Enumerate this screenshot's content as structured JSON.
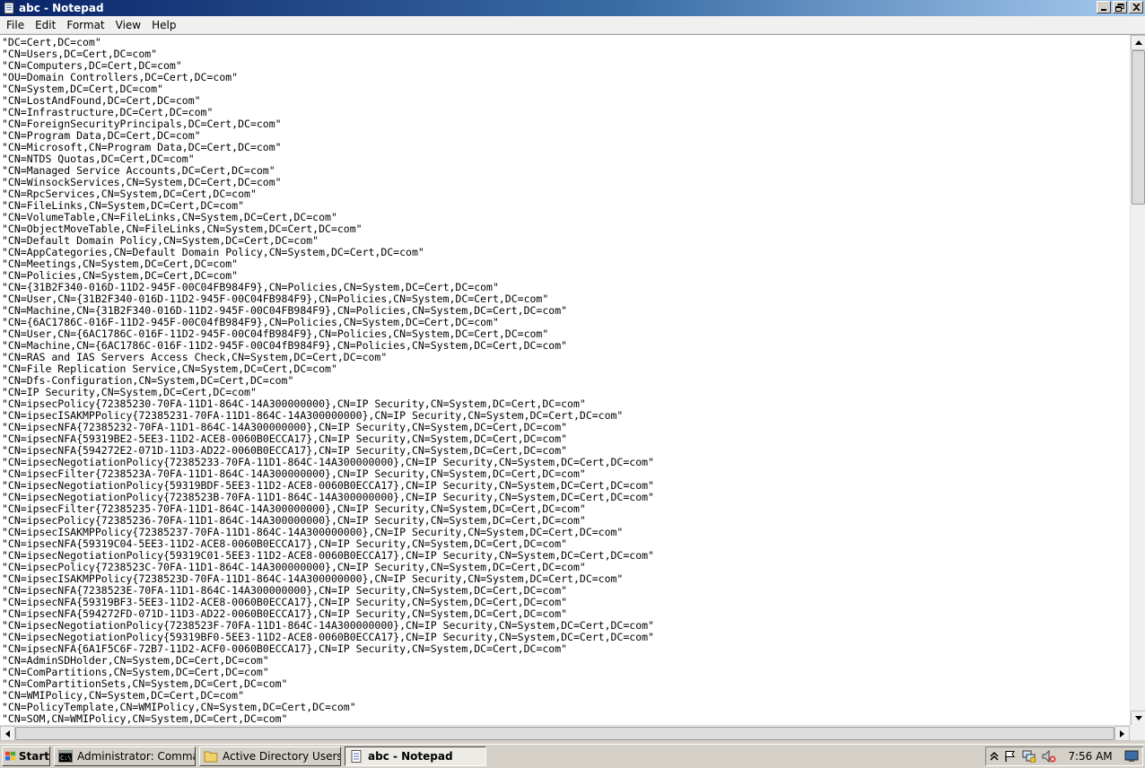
{
  "window": {
    "title": "abc - Notepad"
  },
  "menu": [
    "File",
    "Edit",
    "Format",
    "View",
    "Help"
  ],
  "editor_lines": [
    "\"DC=Cert,DC=com\"",
    "\"CN=Users,DC=Cert,DC=com\"",
    "\"CN=Computers,DC=Cert,DC=com\"",
    "\"OU=Domain Controllers,DC=Cert,DC=com\"",
    "\"CN=System,DC=Cert,DC=com\"",
    "\"CN=LostAndFound,DC=Cert,DC=com\"",
    "\"CN=Infrastructure,DC=Cert,DC=com\"",
    "\"CN=ForeignSecurityPrincipals,DC=Cert,DC=com\"",
    "\"CN=Program Data,DC=Cert,DC=com\"",
    "\"CN=Microsoft,CN=Program Data,DC=Cert,DC=com\"",
    "\"CN=NTDS Quotas,DC=Cert,DC=com\"",
    "\"CN=Managed Service Accounts,DC=Cert,DC=com\"",
    "\"CN=WinsockServices,CN=System,DC=Cert,DC=com\"",
    "\"CN=RpcServices,CN=System,DC=Cert,DC=com\"",
    "\"CN=FileLinks,CN=System,DC=Cert,DC=com\"",
    "\"CN=VolumeTable,CN=FileLinks,CN=System,DC=Cert,DC=com\"",
    "\"CN=ObjectMoveTable,CN=FileLinks,CN=System,DC=Cert,DC=com\"",
    "\"CN=Default Domain Policy,CN=System,DC=Cert,DC=com\"",
    "\"CN=AppCategories,CN=Default Domain Policy,CN=System,DC=Cert,DC=com\"",
    "\"CN=Meetings,CN=System,DC=Cert,DC=com\"",
    "\"CN=Policies,CN=System,DC=Cert,DC=com\"",
    "\"CN={31B2F340-016D-11D2-945F-00C04FB984F9},CN=Policies,CN=System,DC=Cert,DC=com\"",
    "\"CN=User,CN={31B2F340-016D-11D2-945F-00C04FB984F9},CN=Policies,CN=System,DC=Cert,DC=com\"",
    "\"CN=Machine,CN={31B2F340-016D-11D2-945F-00C04FB984F9},CN=Policies,CN=System,DC=Cert,DC=com\"",
    "\"CN={6AC1786C-016F-11D2-945F-00C04fB984F9},CN=Policies,CN=System,DC=Cert,DC=com\"",
    "\"CN=User,CN={6AC1786C-016F-11D2-945F-00C04fB984F9},CN=Policies,CN=System,DC=Cert,DC=com\"",
    "\"CN=Machine,CN={6AC1786C-016F-11D2-945F-00C04fB984F9},CN=Policies,CN=System,DC=Cert,DC=com\"",
    "\"CN=RAS and IAS Servers Access Check,CN=System,DC=Cert,DC=com\"",
    "\"CN=File Replication Service,CN=System,DC=Cert,DC=com\"",
    "\"CN=Dfs-Configuration,CN=System,DC=Cert,DC=com\"",
    "\"CN=IP Security,CN=System,DC=Cert,DC=com\"",
    "\"CN=ipsecPolicy{72385230-70FA-11D1-864C-14A300000000},CN=IP Security,CN=System,DC=Cert,DC=com\"",
    "\"CN=ipsecISAKMPPolicy{72385231-70FA-11D1-864C-14A300000000},CN=IP Security,CN=System,DC=Cert,DC=com\"",
    "\"CN=ipsecNFA{72385232-70FA-11D1-864C-14A300000000},CN=IP Security,CN=System,DC=Cert,DC=com\"",
    "\"CN=ipsecNFA{59319BE2-5EE3-11D2-ACE8-0060B0ECCA17},CN=IP Security,CN=System,DC=Cert,DC=com\"",
    "\"CN=ipsecNFA{594272E2-071D-11D3-AD22-0060B0ECCA17},CN=IP Security,CN=System,DC=Cert,DC=com\"",
    "\"CN=ipsecNegotiationPolicy{72385233-70FA-11D1-864C-14A300000000},CN=IP Security,CN=System,DC=Cert,DC=com\"",
    "\"CN=ipsecFilter{7238523A-70FA-11D1-864C-14A300000000},CN=IP Security,CN=System,DC=Cert,DC=com\"",
    "\"CN=ipsecNegotiationPolicy{59319BDF-5EE3-11D2-ACE8-0060B0ECCA17},CN=IP Security,CN=System,DC=Cert,DC=com\"",
    "\"CN=ipsecNegotiationPolicy{7238523B-70FA-11D1-864C-14A300000000},CN=IP Security,CN=System,DC=Cert,DC=com\"",
    "\"CN=ipsecFilter{72385235-70FA-11D1-864C-14A300000000},CN=IP Security,CN=System,DC=Cert,DC=com\"",
    "\"CN=ipsecPolicy{72385236-70FA-11D1-864C-14A300000000},CN=IP Security,CN=System,DC=Cert,DC=com\"",
    "\"CN=ipsecISAKMPPolicy{72385237-70FA-11D1-864C-14A300000000},CN=IP Security,CN=System,DC=Cert,DC=com\"",
    "\"CN=ipsecNFA{59319C04-5EE3-11D2-ACE8-0060B0ECCA17},CN=IP Security,CN=System,DC=Cert,DC=com\"",
    "\"CN=ipsecNegotiationPolicy{59319C01-5EE3-11D2-ACE8-0060B0ECCA17},CN=IP Security,CN=System,DC=Cert,DC=com\"",
    "\"CN=ipsecPolicy{7238523C-70FA-11D1-864C-14A300000000},CN=IP Security,CN=System,DC=Cert,DC=com\"",
    "\"CN=ipsecISAKMPPolicy{7238523D-70FA-11D1-864C-14A300000000},CN=IP Security,CN=System,DC=Cert,DC=com\"",
    "\"CN=ipsecNFA{7238523E-70FA-11D1-864C-14A300000000},CN=IP Security,CN=System,DC=Cert,DC=com\"",
    "\"CN=ipsecNFA{59319BF3-5EE3-11D2-ACE8-0060B0ECCA17},CN=IP Security,CN=System,DC=Cert,DC=com\"",
    "\"CN=ipsecNFA{594272FD-071D-11D3-AD22-0060B0ECCA17},CN=IP Security,CN=System,DC=Cert,DC=com\"",
    "\"CN=ipsecNegotiationPolicy{7238523F-70FA-11D1-864C-14A300000000},CN=IP Security,CN=System,DC=Cert,DC=com\"",
    "\"CN=ipsecNegotiationPolicy{59319BF0-5EE3-11D2-ACE8-0060B0ECCA17},CN=IP Security,CN=System,DC=Cert,DC=com\"",
    "\"CN=ipsecNFA{6A1F5C6F-72B7-11D2-ACF0-0060B0ECCA17},CN=IP Security,CN=System,DC=Cert,DC=com\"",
    "\"CN=AdminSDHolder,CN=System,DC=Cert,DC=com\"",
    "\"CN=ComPartitions,CN=System,DC=Cert,DC=com\"",
    "\"CN=ComPartitionSets,CN=System,DC=Cert,DC=com\"",
    "\"CN=WMIPolicy,CN=System,DC=Cert,DC=com\"",
    "\"CN=PolicyTemplate,CN=WMIPolicy,CN=System,DC=Cert,DC=com\"",
    "\"CN=SOM,CN=WMIPolicy,CN=System,DC=Cert,DC=com\""
  ],
  "taskbar": {
    "start_label": "Start",
    "tasks": [
      {
        "label": "Administrator: Command...",
        "icon": "command-prompt-icon",
        "active": false
      },
      {
        "label": "Active Directory Users a...",
        "icon": "folder-icon",
        "active": false
      },
      {
        "label": "abc - Notepad",
        "icon": "notepad-icon",
        "active": true
      }
    ],
    "clock": "7:56 AM"
  },
  "colors": {
    "title_start": "#0a246a",
    "title_end": "#a6caf0",
    "face": "#d4d0c8"
  }
}
